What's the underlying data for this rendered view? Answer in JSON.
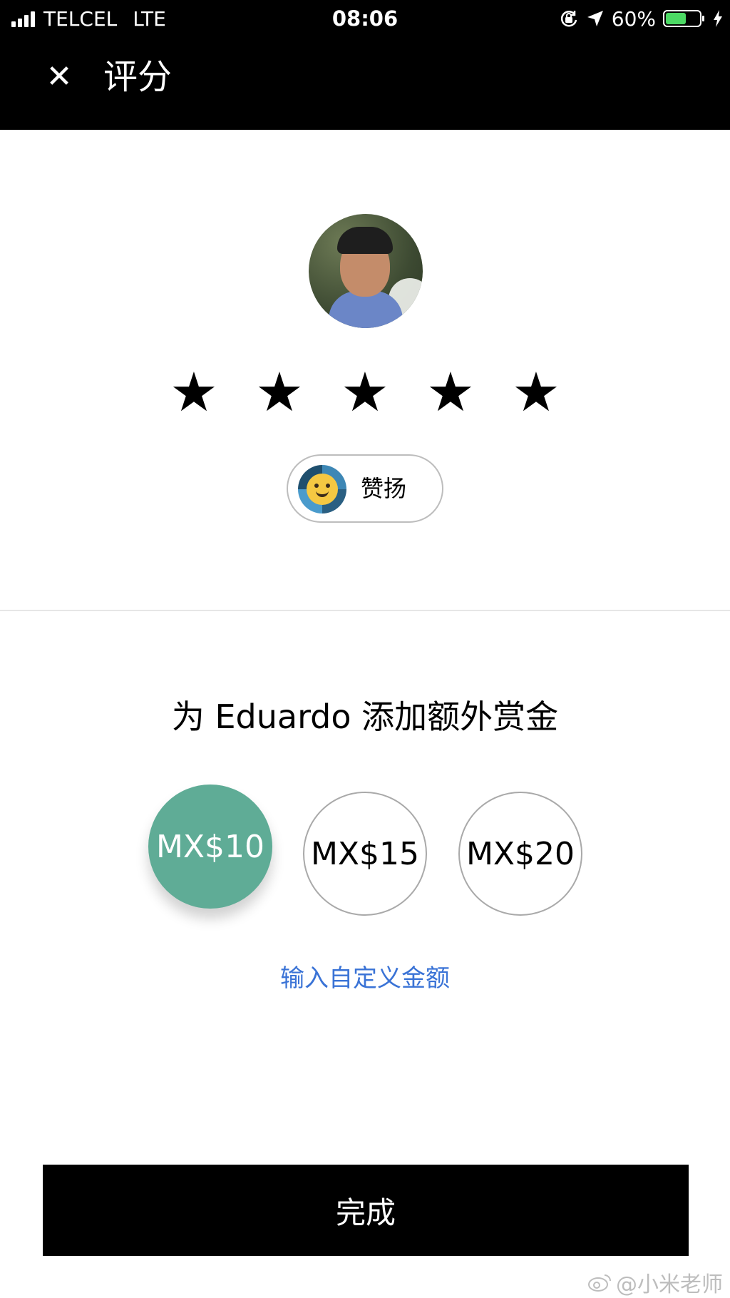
{
  "status_bar": {
    "carrier": "TELCEL",
    "network": "LTE",
    "time": "08:06",
    "battery_percent": "60%",
    "battery_level": 0.6,
    "icons": [
      "signal-icon",
      "orientation-lock-icon",
      "location-arrow-icon",
      "battery-icon",
      "charging-bolt-icon"
    ]
  },
  "header": {
    "close_icon": "✕",
    "title": "评分"
  },
  "rating": {
    "star_glyph": "★",
    "stars_count": 5
  },
  "compliment": {
    "label": "赞扬"
  },
  "tip": {
    "heading": "为 Eduardo 添加额外赏金",
    "options": [
      {
        "label": "MX$10",
        "selected": true
      },
      {
        "label": "MX$15",
        "selected": false
      },
      {
        "label": "MX$20",
        "selected": false
      }
    ],
    "custom_link": "输入自定义金额"
  },
  "footer": {
    "done_label": "完成"
  },
  "watermark": {
    "text": "@小米老师"
  },
  "colors": {
    "selected_tip": "#5fac96",
    "link": "#3a73d6",
    "battery_fill": "#4cd964"
  }
}
